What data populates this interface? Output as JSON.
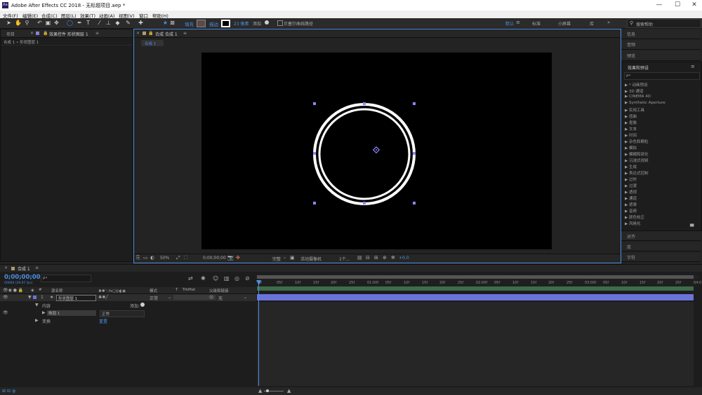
{
  "app": {
    "logo_text": "Ae",
    "title": "Adobe After Effects CC 2018 - 无标题项目.aep *",
    "window_controls": {
      "minimize": "—",
      "maximize": "☐",
      "close": "✕"
    }
  },
  "menu": [
    "文件(F)",
    "编辑(E)",
    "合成(C)",
    "图层(L)",
    "效果(T)",
    "动画(A)",
    "视图(V)",
    "窗口",
    "帮助(H)"
  ],
  "toolbar": {
    "fill_label": "填充",
    "stroke_label": "描边",
    "stroke_width": "23 像素",
    "add_label": "添加",
    "bezier_label": "贝塞尔曲线路径",
    "workspaces": [
      "默认",
      "标准",
      "小屏幕",
      "库"
    ],
    "search_placeholder": "搜索帮助"
  },
  "project_panel": {
    "tab_project": "项目",
    "tab_effects": "效果控件 形状图层 1",
    "breadcrumb": "合成 1 • 形状图层 1"
  },
  "comp_panel": {
    "tab": "合成 合成 1",
    "subtab": "合成 1",
    "footer": {
      "zoom": "50%",
      "timecode": "0;00;00;00",
      "quality": "完整",
      "camera": "活动摄像机",
      "views": "1个...",
      "exposure": "+0.0"
    }
  },
  "right_panel": {
    "info": "信息",
    "audio": "音频",
    "preview": "预览",
    "effects_presets": "效果和预设",
    "search_placeholder": "ρ•",
    "items": [
      "* 动画预设",
      "3D 通道",
      "CINEMA 4D",
      "Synthetic Aperture",
      "实用工具",
      "扭曲",
      "抠像",
      "文本",
      "时间",
      "杂色和颗粒",
      "模拟",
      "模糊和锐化",
      "沉浸式视频",
      "生成",
      "表达式控制",
      "过时",
      "过渡",
      "透视",
      "通道",
      "遮罩",
      "音频",
      "颜色校正",
      "风格化"
    ],
    "align": "对齐",
    "library": "库",
    "character": "字符"
  },
  "timeline": {
    "tab": "合成 1",
    "timecode": "0;00;00;00",
    "fps": "00000 (29.97 fps)",
    "search_placeholder": "ρ•",
    "col_source": "源名称",
    "col_mode": "模式",
    "col_t": "T",
    "col_trkmat": "TrkMat",
    "col_parent": "父级和链接",
    "layer_num": "1",
    "layer_star": "★",
    "layer_name": "形状图层 1",
    "layer_mode": "正常",
    "layer_parent": "无",
    "contents": "内容",
    "add": "添加:",
    "ellipse": "椭圆 1",
    "ellipse_mode": "正常",
    "transform": "变换",
    "reset": "重置",
    "ruler": [
      "0f",
      "05f",
      "10f",
      "15f",
      "20f",
      "25f",
      "01:00f",
      "05f",
      "10f",
      "15f",
      "20f",
      "25f",
      "02:00f",
      "05f",
      "10f",
      "15f",
      "20f",
      "25f",
      "03:00f",
      "05f",
      "10f",
      "15f",
      "20f",
      "25f",
      "04:0"
    ]
  },
  "colors": {
    "accent": "#4c8fe0",
    "layer_bar": "#6b73d9",
    "handle": "#8d86ff",
    "ruler_green": "#3e6b4a"
  }
}
